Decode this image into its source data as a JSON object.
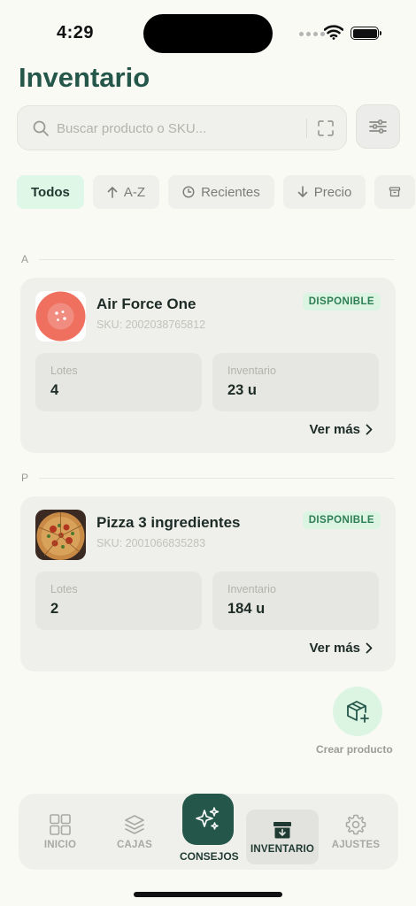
{
  "status_bar": {
    "time": "4:29"
  },
  "header": {
    "title": "Inventario"
  },
  "search": {
    "placeholder": "Buscar producto o SKU..."
  },
  "filters": [
    {
      "label": "Todos",
      "icon": "",
      "active": true
    },
    {
      "label": "A-Z",
      "icon": "arrow-up-icon",
      "active": false
    },
    {
      "label": "Recientes",
      "icon": "clock-icon",
      "active": false
    },
    {
      "label": "Precio",
      "icon": "arrow-down-icon",
      "active": false
    },
    {
      "label": "",
      "icon": "archive-icon",
      "active": false
    }
  ],
  "sections": [
    {
      "letter": "A",
      "products": [
        {
          "name": "Air Force One",
          "sku": "SKU: 2002038765812",
          "status": "DISPONIBLE",
          "lotes_label": "Lotes",
          "lotes": "4",
          "inventario_label": "Inventario",
          "inventario": "23 u",
          "more": "Ver más",
          "thumb": "placeholder-circle-icon"
        }
      ]
    },
    {
      "letter": "P",
      "products": [
        {
          "name": "Pizza 3 ingredientes",
          "sku": "SKU: 2001066835283",
          "status": "DISPONIBLE",
          "lotes_label": "Lotes",
          "lotes": "2",
          "inventario_label": "Inventario",
          "inventario": "184 u",
          "more": "Ver más",
          "thumb": "pizza-photo"
        }
      ]
    }
  ],
  "fab": {
    "label": "Crear producto",
    "icon": "box-plus-icon"
  },
  "tab_bar": {
    "items": [
      {
        "label": "INICIO",
        "icon": "grid-icon"
      },
      {
        "label": "CAJAS",
        "icon": "layers-icon"
      },
      {
        "label": "CONSEJOS",
        "icon": "sparkles-icon"
      },
      {
        "label": "INVENTARIO",
        "icon": "archive-icon",
        "active": true
      },
      {
        "label": "AJUSTES",
        "icon": "gear-icon"
      }
    ]
  },
  "colors": {
    "accent": "#24574a",
    "badge_bg": "#dcf5e3",
    "badge_text": "#2e7d55",
    "background": "#fafaf5",
    "card": "#efefeb"
  }
}
